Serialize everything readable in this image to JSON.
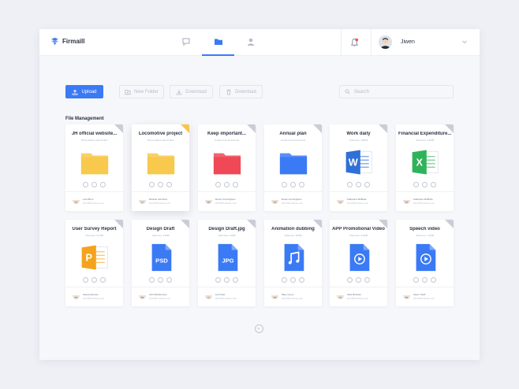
{
  "app": {
    "name": "Firmaill"
  },
  "user": {
    "name": "Jiwen"
  },
  "colors": {
    "accent": "#3b7af5",
    "notification": "#f2545b",
    "folder_yellow": "#f8c94d",
    "folder_red": "#f04856",
    "folder_blue": "#3b7af5",
    "word_blue": "#2e6fd9",
    "excel_green": "#2fb35a",
    "ppt_orange": "#f5a31c"
  },
  "toolbar": {
    "upload_label": "Upload",
    "new_folder_label": "New Folder",
    "download_label": "Download",
    "delete_label": "Download"
  },
  "search": {
    "placeholder": "Search"
  },
  "section": {
    "title": "File Management"
  },
  "files": [
    {
      "title": "JH official website...",
      "sub": "Three folders and 31 files",
      "icon": "folder-yellow",
      "user": "Lulu Blum",
      "date": "2017/8/9   Admin sub"
    },
    {
      "title": "Locomotive project",
      "sub": "Three folders and 31 files",
      "icon": "folder-yellow",
      "user": "Ricardo Johnston",
      "date": "2017/8/9   Admin sub"
    },
    {
      "title": "Keep important...",
      "sub": "A total of 11 documents",
      "icon": "folder-red",
      "user": "Rosie Cunningham",
      "date": "2017/8/9   Admin sub"
    },
    {
      "title": "Annual plan",
      "sub": "A total of 12 documents",
      "icon": "folder-blue",
      "user": "Rosie Cunningham",
      "date": "2017/8/9   Admin sub"
    },
    {
      "title": "Work daily",
      "sub": "Total size: 128KB",
      "icon": "word-icon",
      "user": "Katharine McBride",
      "date": "2017/8/9   Admin sub"
    },
    {
      "title": "Financial Expenditure...",
      "sub": "Total size: 3.4MB",
      "icon": "excel-icon",
      "user": "Katharine McBride",
      "date": "2017/8/9   Admin sub"
    },
    {
      "title": "User Survey Report",
      "sub": "Total size: 3.1MB",
      "icon": "ppt-icon",
      "user": "Seana Reeves",
      "date": "2017/8/9   Admin sub"
    },
    {
      "title": "Design Draft",
      "sub": "Total size: 21MB",
      "icon": "psd-icon",
      "user": "John Bartlemean",
      "date": "2017/8/7   Admin sub"
    },
    {
      "title": "Design Draft.jpg",
      "sub": "Total size: 21MB",
      "icon": "jpg-icon",
      "user": "Lily Pater",
      "date": "2017/8/9   Admin sub"
    },
    {
      "title": "Animation dubbing",
      "sub": "Total size: 20MB",
      "icon": "music-icon",
      "user": "Mary Cyrus",
      "date": "2017/8/9   Admin sub"
    },
    {
      "title": "APP Promotional Video",
      "sub": "Total size: 3.4MB",
      "icon": "video-icon",
      "user": "Sara Beckets",
      "date": "2017/8/9   Admin sub"
    },
    {
      "title": "Speech video",
      "sub": "Total size: 1.4MB",
      "icon": "video-icon",
      "user": "Taylor Swift",
      "date": "2017/8/9   Admin sub"
    }
  ]
}
